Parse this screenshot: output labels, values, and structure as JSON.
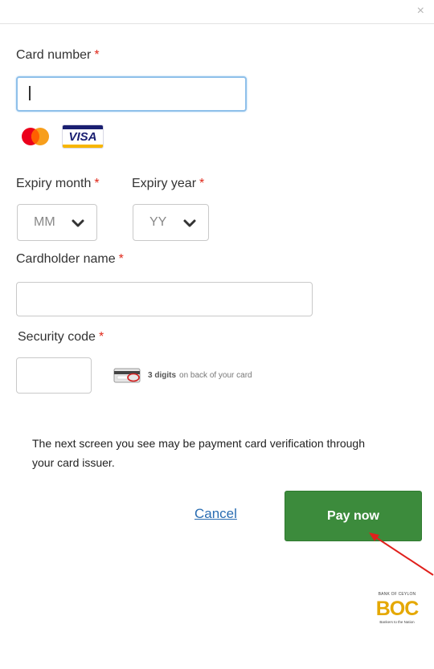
{
  "dialog": {
    "close_glyph": "×"
  },
  "card_number": {
    "label": "Card number",
    "required": "*",
    "value": "",
    "card_brands": [
      "mastercard",
      "visa"
    ],
    "visa_text": "VISA"
  },
  "expiry_month": {
    "label": "Expiry month",
    "required": "*",
    "selected": "MM"
  },
  "expiry_year": {
    "label": "Expiry year",
    "required": "*",
    "selected": "YY"
  },
  "cardholder_name": {
    "label": "Cardholder name",
    "required": "*",
    "value": ""
  },
  "security_code": {
    "label": "Security code",
    "required": "*",
    "value": "",
    "hint_bold": "3 digits",
    "hint_text": "on back of your card"
  },
  "note": "The next screen you see may be payment card verification through your card issuer.",
  "actions": {
    "cancel_label": "Cancel",
    "pay_label": "Pay now"
  },
  "brand": {
    "logo_name": "BOC",
    "logo_top_text": "BANK OF CEYLON",
    "logo_bottom_text": "Bankers to the Nation"
  },
  "colors": {
    "required": "#e0281a",
    "pay_button": "#3c8b3c",
    "link": "#2a6db2",
    "focus_border": "#8fc0ea",
    "annotation_arrow": "#e0201c"
  }
}
